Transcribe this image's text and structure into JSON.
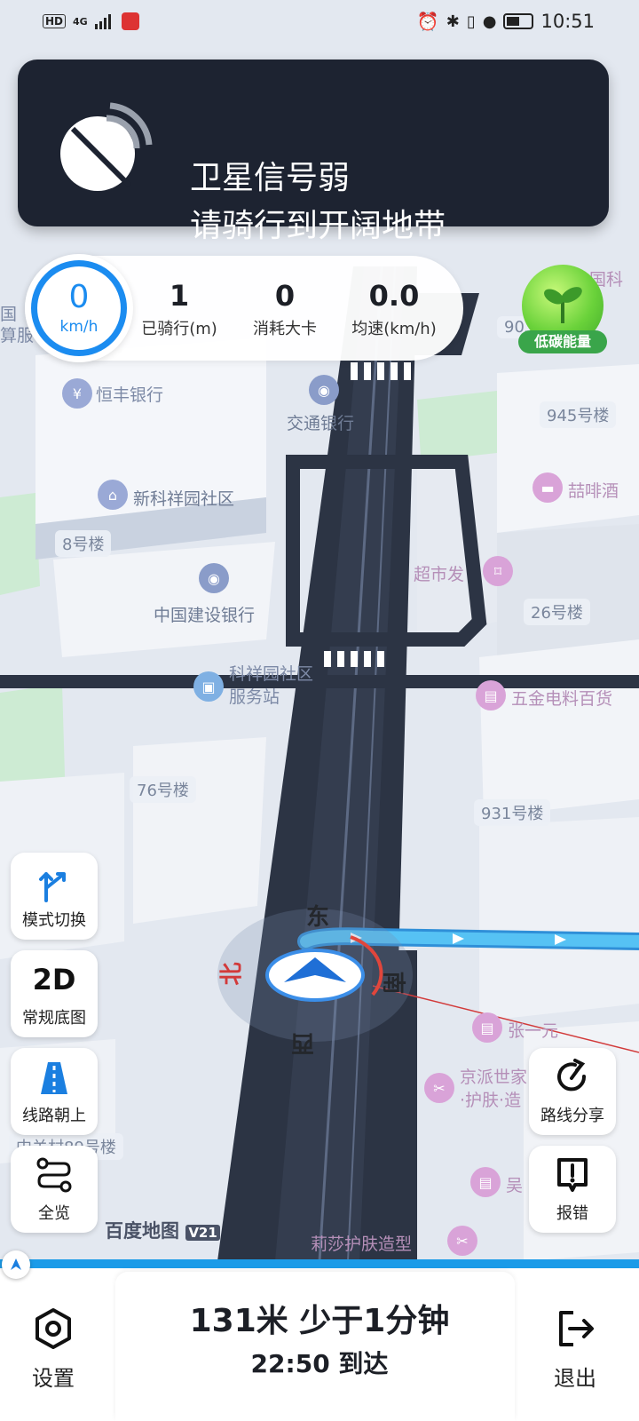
{
  "status_bar": {
    "network_badges": [
      "HD",
      "4G"
    ],
    "time": "10:51"
  },
  "alert": {
    "title": "卫星信号弱",
    "subtitle": "请骑行到开阔地带"
  },
  "speed_panel": {
    "speed_value": "0",
    "speed_unit": "km/h",
    "stats": [
      {
        "value": "1",
        "label": "已骑行(m)"
      },
      {
        "value": "0",
        "label": "消耗大卡"
      },
      {
        "value": "0.0",
        "label": "均速(km/h)"
      }
    ]
  },
  "eco": {
    "label": "低碳能量"
  },
  "map": {
    "pois": [
      {
        "name": "恒丰银行"
      },
      {
        "name": "交通银行"
      },
      {
        "name": "新科祥园社区"
      },
      {
        "name": "中国建设银行"
      },
      {
        "name": "科祥园社区\n服务站"
      },
      {
        "name": "超市发"
      },
      {
        "name": "五金电料百货"
      },
      {
        "name": "喆啡酒"
      },
      {
        "name": "张一元"
      },
      {
        "name": "京派世家\n·护肤·造"
      },
      {
        "name": "吴"
      },
      {
        "name": "莉莎护肤造型"
      },
      {
        "name": "国科"
      },
      {
        "name": "国\n算服"
      }
    ],
    "building_tags": [
      "945号楼",
      "8号楼",
      "26号楼",
      "76号楼",
      "931号楼",
      "中关村89号楼",
      "903"
    ],
    "compass": {
      "north": "北",
      "east": "东",
      "south": "南",
      "west": "西"
    },
    "watermark": "百度地图",
    "watermark_version": "V21"
  },
  "left_controls": [
    {
      "label": "模式切换",
      "icon": "route-split-icon"
    },
    {
      "label": "常规底图",
      "icon_text": "2D"
    },
    {
      "label": "线路朝上",
      "icon": "road-up-icon"
    },
    {
      "label": "全览",
      "icon": "overview-route-icon"
    }
  ],
  "right_controls": [
    {
      "label": "路线分享",
      "icon": "share-icon"
    },
    {
      "label": "报错",
      "icon": "report-icon"
    }
  ],
  "bottom": {
    "remaining": "131米 少于1分钟",
    "arrival": "22:50 到达",
    "settings_label": "设置",
    "exit_label": "退出"
  },
  "colors": {
    "accent_blue": "#1b8cf0",
    "banner_bg": "#1d2331",
    "route_blue": "#4bb7f0",
    "eco_green": "#3aa54a"
  }
}
